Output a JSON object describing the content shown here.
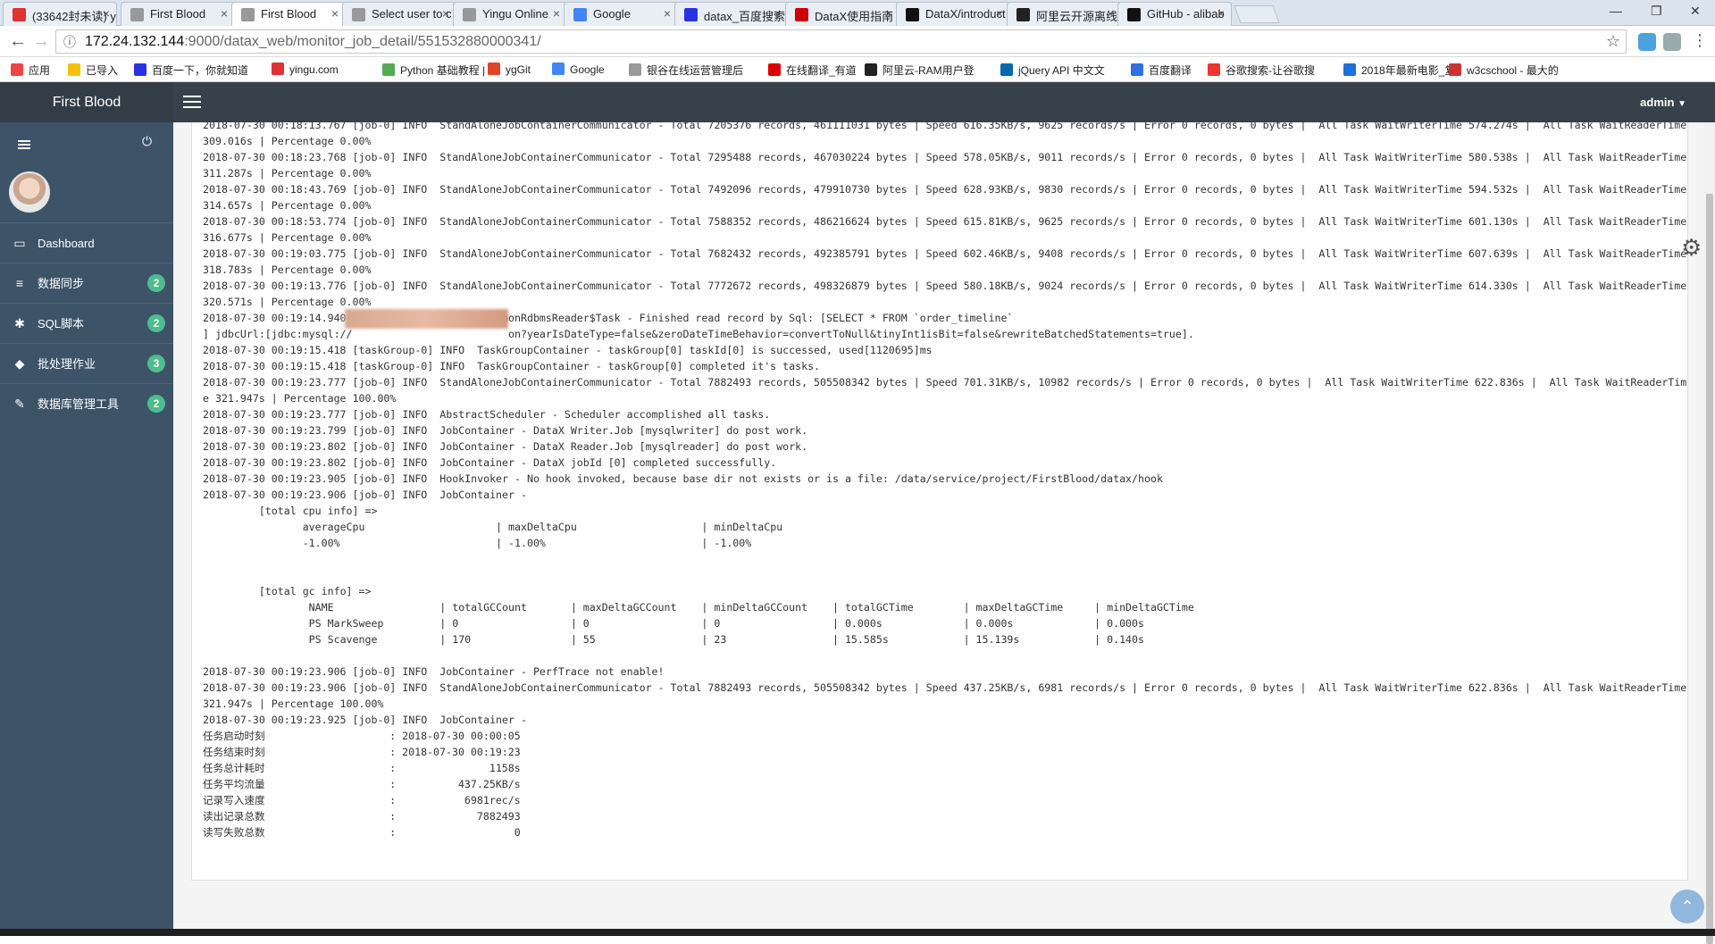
{
  "browser": {
    "tabs": [
      {
        "title": "(33642封未读) y",
        "fav_color": "#d33"
      },
      {
        "title": "First Blood",
        "fav_color": "#999"
      },
      {
        "title": "First Blood",
        "fav_color": "#999"
      },
      {
        "title": "Select user to c",
        "fav_color": "#999"
      },
      {
        "title": "Yingu Online",
        "fav_color": "#999"
      },
      {
        "title": "Google",
        "fav_color": "#4285f4"
      },
      {
        "title": "datax_百度搜索",
        "fav_color": "#2932e1"
      },
      {
        "title": "DataX使用指南 -",
        "fav_color": "#c00"
      },
      {
        "title": "DataX/introduct",
        "fav_color": "#111"
      },
      {
        "title": "阿里云开源离线",
        "fav_color": "#222"
      },
      {
        "title": "GitHub - alibab",
        "fav_color": "#111"
      }
    ],
    "url_host": "172.24.132.144",
    "url_path": ":9000/datax_web/monitor_job_detail/551532880000341/",
    "bookmarks": [
      {
        "label": "应用",
        "color": "#e44"
      },
      {
        "label": "已导入",
        "color": "#f4c20d"
      },
      {
        "label": "百度一下，你就知道",
        "color": "#2932e1"
      },
      {
        "label": "yingu.com",
        "color": "#d33"
      },
      {
        "label": "Python 基础教程 |",
        "color": "#5a5"
      },
      {
        "label": "ygGit",
        "color": "#e24329"
      },
      {
        "label": "Google",
        "color": "#4285f4"
      },
      {
        "label": "银谷在线运营管理后",
        "color": "#999"
      },
      {
        "label": "在线翻译_有道",
        "color": "#d00"
      },
      {
        "label": "阿里云-RAM用户登",
        "color": "#222"
      },
      {
        "label": "jQuery API 中文文",
        "color": "#0769ad"
      },
      {
        "label": "百度翻译",
        "color": "#2f6fe4"
      },
      {
        "label": "谷歌搜索-让谷歌搜",
        "color": "#e33"
      },
      {
        "label": "2018年最新电影_复",
        "color": "#1a6fd8"
      },
      {
        "label": "w3cschool - 最大的",
        "color": "#c33"
      }
    ]
  },
  "header": {
    "brand": "First Blood",
    "user": "admin"
  },
  "sidebar": {
    "items": [
      {
        "label": "Dashboard",
        "icon": "monitor-icon",
        "glyph": "▭",
        "badge": ""
      },
      {
        "label": "数据同步",
        "icon": "list-icon",
        "glyph": "≡",
        "badge": "2"
      },
      {
        "label": "SQL脚本",
        "icon": "asterisk-icon",
        "glyph": "✱",
        "badge": "2"
      },
      {
        "label": "批处理作业",
        "icon": "tag-icon",
        "glyph": "◆",
        "badge": "3"
      },
      {
        "label": "数据库管理工具",
        "icon": "wrench-icon",
        "glyph": "✎",
        "badge": "2"
      }
    ]
  },
  "log_lines": [
    "2018-07-30 00:18:13.767 [job-0] INFO  StandAloneJobContainerCommunicator - Total 7205376 records, 461111031 bytes | Speed 616.35KB/s, 9625 records/s | Error 0 records, 0 bytes |  All Task WaitWriterTime 574.274s |  All Task WaitReaderTime 309.016s | Percentage 0.00%",
    "2018-07-30 00:18:23.768 [job-0] INFO  StandAloneJobContainerCommunicator - Total 7295488 records, 467030224 bytes | Speed 578.05KB/s, 9011 records/s | Error 0 records, 0 bytes |  All Task WaitWriterTime 580.538s |  All Task WaitReaderTime 311.287s | Percentage 0.00%",
    "2018-07-30 00:18:43.769 [job-0] INFO  StandAloneJobContainerCommunicator - Total 7492096 records, 479910730 bytes | Speed 628.93KB/s, 9830 records/s | Error 0 records, 0 bytes |  All Task WaitWriterTime 594.532s |  All Task WaitReaderTime 314.657s | Percentage 0.00%",
    "2018-07-30 00:18:53.774 [job-0] INFO  StandAloneJobContainerCommunicator - Total 7588352 records, 486216624 bytes | Speed 615.81KB/s, 9625 records/s | Error 0 records, 0 bytes |  All Task WaitWriterTime 601.130s |  All Task WaitReaderTime 316.677s | Percentage 0.00%",
    "2018-07-30 00:19:03.775 [job-0] INFO  StandAloneJobContainerCommunicator - Total 7682432 records, 492385791 bytes | Speed 602.46KB/s, 9408 records/s | Error 0 records, 0 bytes |  All Task WaitWriterTime 607.639s |  All Task WaitReaderTime 318.783s | Percentage 0.00%",
    "2018-07-30 00:19:13.776 [job-0] INFO  StandAloneJobContainerCommunicator - Total 7772672 records, 498326879 bytes | Speed 580.18KB/s, 9024 records/s | Error 0 records, 0 bytes |  All Task WaitWriterTime 614.330s |  All Task WaitReaderTime 320.571s | Percentage 0.00%",
    "2018-07-30 00:19:14.940 [0-0-0-reader] INFO  CommonRdbmsReader$Task - Finished read record by Sql: [SELECT * FROM `order_timeline`",
    "] jdbcUrl:[jdbc:mysql://                         on?yearIsDateType=false&zeroDateTimeBehavior=convertToNull&tinyInt1isBit=false&rewriteBatchedStatements=true].",
    "2018-07-30 00:19:15.418 [taskGroup-0] INFO  TaskGroupContainer - taskGroup[0] taskId[0] is successed, used[1120695]ms",
    "2018-07-30 00:19:15.418 [taskGroup-0] INFO  TaskGroupContainer - taskGroup[0] completed it's tasks.",
    "2018-07-30 00:19:23.777 [job-0] INFO  StandAloneJobContainerCommunicator - Total 7882493 records, 505508342 bytes | Speed 701.31KB/s, 10982 records/s | Error 0 records, 0 bytes |  All Task WaitWriterTime 622.836s |  All Task WaitReaderTime 321.947s | Percentage 100.00%",
    "2018-07-30 00:19:23.777 [job-0] INFO  AbstractScheduler - Scheduler accomplished all tasks.",
    "2018-07-30 00:19:23.799 [job-0] INFO  JobContainer - DataX Writer.Job [mysqlwriter] do post work.",
    "2018-07-30 00:19:23.802 [job-0] INFO  JobContainer - DataX Reader.Job [mysqlreader] do post work.",
    "2018-07-30 00:19:23.802 [job-0] INFO  JobContainer - DataX jobId [0] completed successfully.",
    "2018-07-30 00:19:23.905 [job-0] INFO  HookInvoker - No hook invoked, because base dir not exists or is a file: /data/service/project/FirstBlood/datax/hook",
    "2018-07-30 00:19:23.906 [job-0] INFO  JobContainer - ",
    "         [total cpu info] => ",
    "                averageCpu                     | maxDeltaCpu                    | minDeltaCpu                    ",
    "                -1.00%                         | -1.00%                         | -1.00%",
    "                        ",
    "",
    "         [total gc info] => ",
    "                 NAME                 | totalGCCount       | maxDeltaGCCount    | minDeltaGCCount    | totalGCTime        | maxDeltaGCTime     | minDeltaGCTime     ",
    "                 PS MarkSweep         | 0                  | 0                  | 0                  | 0.000s             | 0.000s             | 0.000s             ",
    "                 PS Scavenge          | 170                | 55                 | 23                 | 15.585s            | 15.139s            | 0.140s             ",
    "",
    "2018-07-30 00:19:23.906 [job-0] INFO  JobContainer - PerfTrace not enable!",
    "2018-07-30 00:19:23.906 [job-0] INFO  StandAloneJobContainerCommunicator - Total 7882493 records, 505508342 bytes | Speed 437.25KB/s, 6981 records/s | Error 0 records, 0 bytes |  All Task WaitWriterTime 622.836s |  All Task WaitReaderTime 321.947s | Percentage 100.00%",
    "2018-07-30 00:19:23.925 [job-0] INFO  JobContainer - ",
    "任务启动时刻                    : 2018-07-30 00:00:05",
    "任务结束时刻                    : 2018-07-30 00:19:23",
    "任务总计耗时                    :               1158s",
    "任务平均流量                    :          437.25KB/s",
    "记录写入速度                    :           6981rec/s",
    "读出记录总数                    :             7882493",
    "读写失败总数                    :                   0"
  ]
}
